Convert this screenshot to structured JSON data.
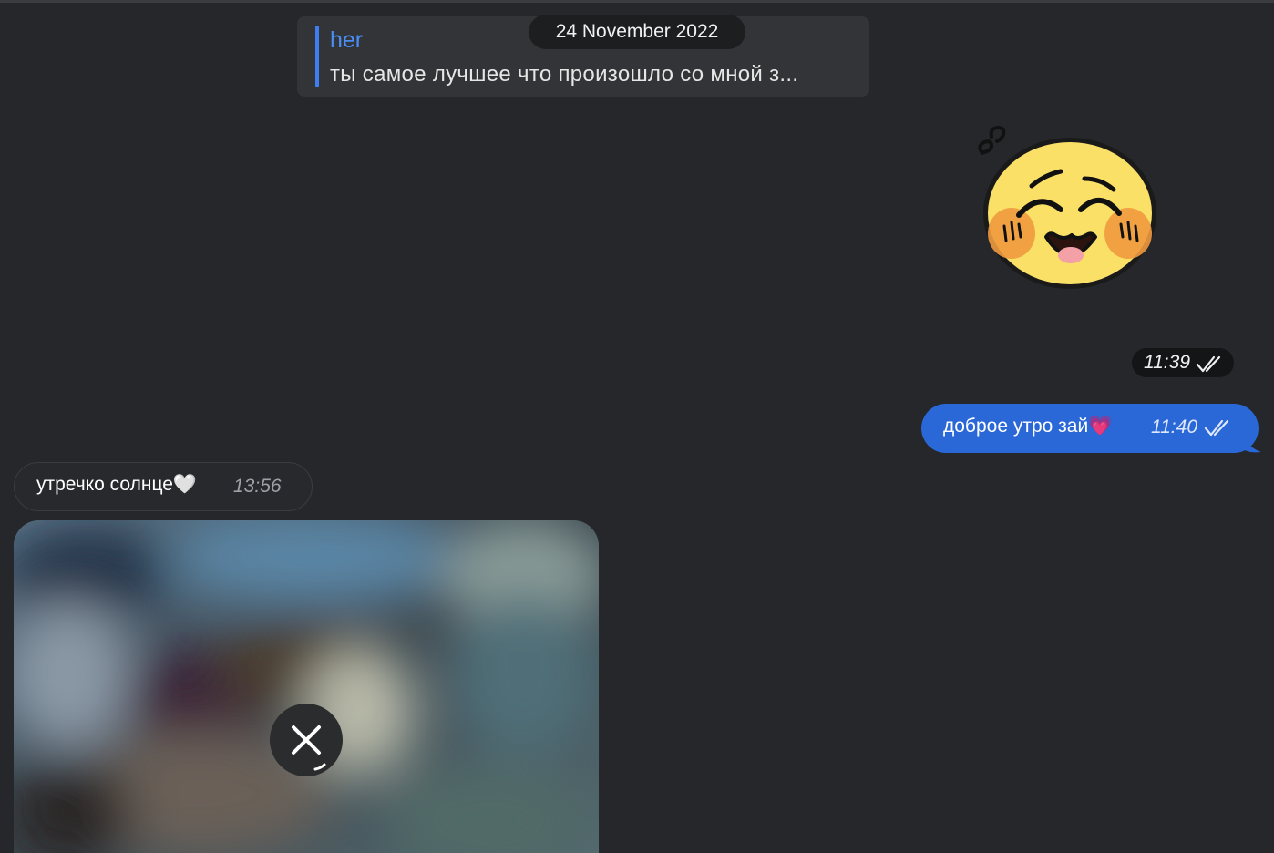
{
  "reply_preview": {
    "author": "her",
    "text": "ты самое лучшее что произошло со мной з..."
  },
  "date_separator": "24 November 2022",
  "sticker": {
    "icon": "blushing-emoji-sticker",
    "time": "11:39",
    "status_icon": "double-check-icon"
  },
  "messages": [
    {
      "direction": "outgoing",
      "text": "доброе утро зай💗",
      "time": "11:40",
      "status_icon": "double-check-icon"
    },
    {
      "direction": "incoming",
      "text": "утречко солнце🤍",
      "time": "13:56"
    }
  ],
  "photo": {
    "state": "downloading",
    "action_icon": "cancel-download-icon"
  },
  "colors": {
    "background": "#25272a",
    "outgoing_bubble": "#2a67d7",
    "accent": "#4a8df5",
    "date_pill": "#1d1e20"
  }
}
